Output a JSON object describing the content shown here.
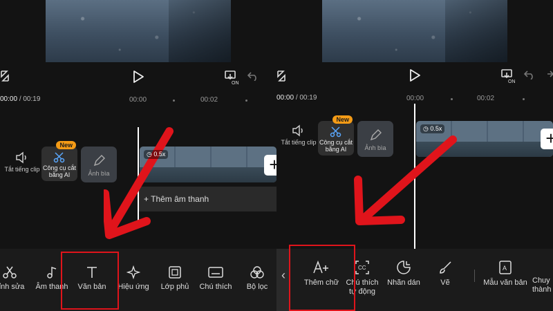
{
  "left": {
    "timecode": {
      "current": "00:00",
      "sep": "/",
      "total": "00:19"
    },
    "ticks": [
      "00:00",
      "00:02"
    ],
    "tracks": {
      "mute": "Tắt tiếng clip",
      "ai_cut": "Công cụ cắt bằng AI",
      "ai_badge": "New",
      "cover": "Ảnh bìa",
      "speed": "0.5x",
      "add_audio": "Thêm âm thanh"
    },
    "toolbar": [
      "hỉnh sửa",
      "Âm thanh",
      "Văn bản",
      "Hiệu ứng",
      "Lớp phủ",
      "Chú thích",
      "Bộ lọc"
    ]
  },
  "right": {
    "timecode": {
      "current": "00:00",
      "sep": "/",
      "total": "00:19"
    },
    "ticks": [
      "00:00",
      "00:02"
    ],
    "tracks": {
      "mute": "Tắt tiếng clip",
      "ai_cut": "Công cụ cắt bằng AI",
      "ai_badge": "New",
      "cover": "Ảnh bìa",
      "speed": "0.5x"
    },
    "toolbar": [
      "Thêm chữ",
      "Chú thích tự động",
      "Nhãn dán",
      "Vẽ",
      "Mẫu văn bản",
      "Chuy thành"
    ]
  },
  "colors": {
    "highlight": "#e0141b",
    "badge": "#f49b16",
    "background": "#131313"
  }
}
